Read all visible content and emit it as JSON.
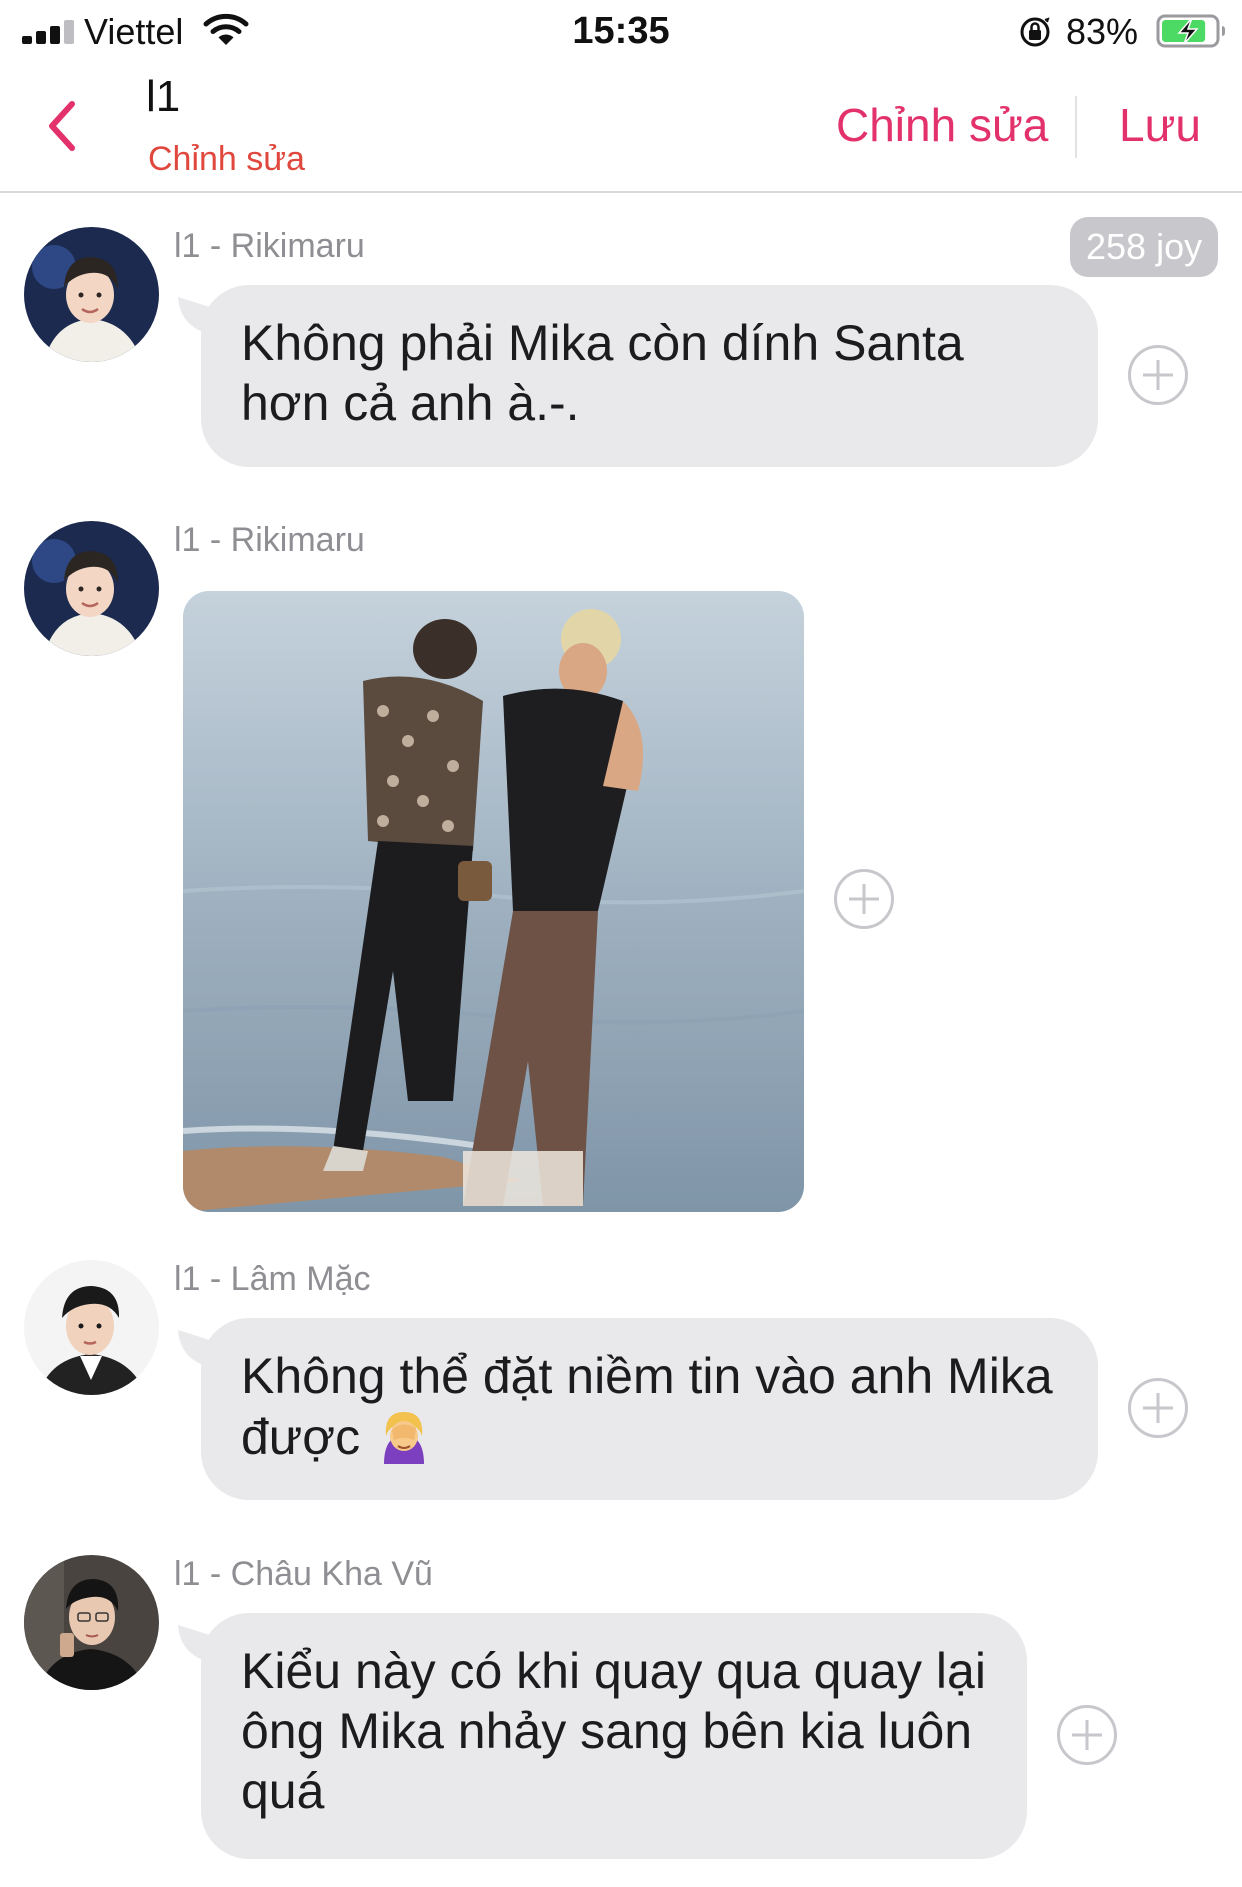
{
  "status_bar": {
    "carrier": "Viettel",
    "time": "15:35",
    "battery_percent": "83%",
    "battery_level": 0.83,
    "icons": [
      "signal-icon",
      "wifi-icon",
      "orientation-lock-icon",
      "battery-charging-icon"
    ]
  },
  "nav": {
    "title": "l1",
    "subtitle": "Chỉnh sửa",
    "edit_label": "Chỉnh sửa",
    "save_label": "Lưu",
    "back_icon": "chevron-left-icon"
  },
  "colors": {
    "accent": "#e3326b",
    "subtitle": "#e0483e",
    "bubble": "#e9e9eb",
    "muted": "#8e8e93"
  },
  "badge": "258 joy",
  "messages": [
    {
      "sender": "l1 - Rikimaru",
      "type": "text",
      "text": "Không phải Mika còn dính Santa hơn cả anh à.-."
    },
    {
      "sender": "l1 - Rikimaru",
      "type": "image",
      "image_description_icon": "photo-beach-couple"
    },
    {
      "sender": "l1 - Lâm Mặc",
      "type": "text",
      "text": "Không thể đặt niềm tin vào anh Mika được",
      "emoji": "woman-facepalming-emoji"
    },
    {
      "sender": "l1 - Châu Kha Vũ",
      "type": "text",
      "text": "Kiểu này có khi quay qua quay lại ông Mika nhảy sang bên kia luôn quá"
    }
  ]
}
